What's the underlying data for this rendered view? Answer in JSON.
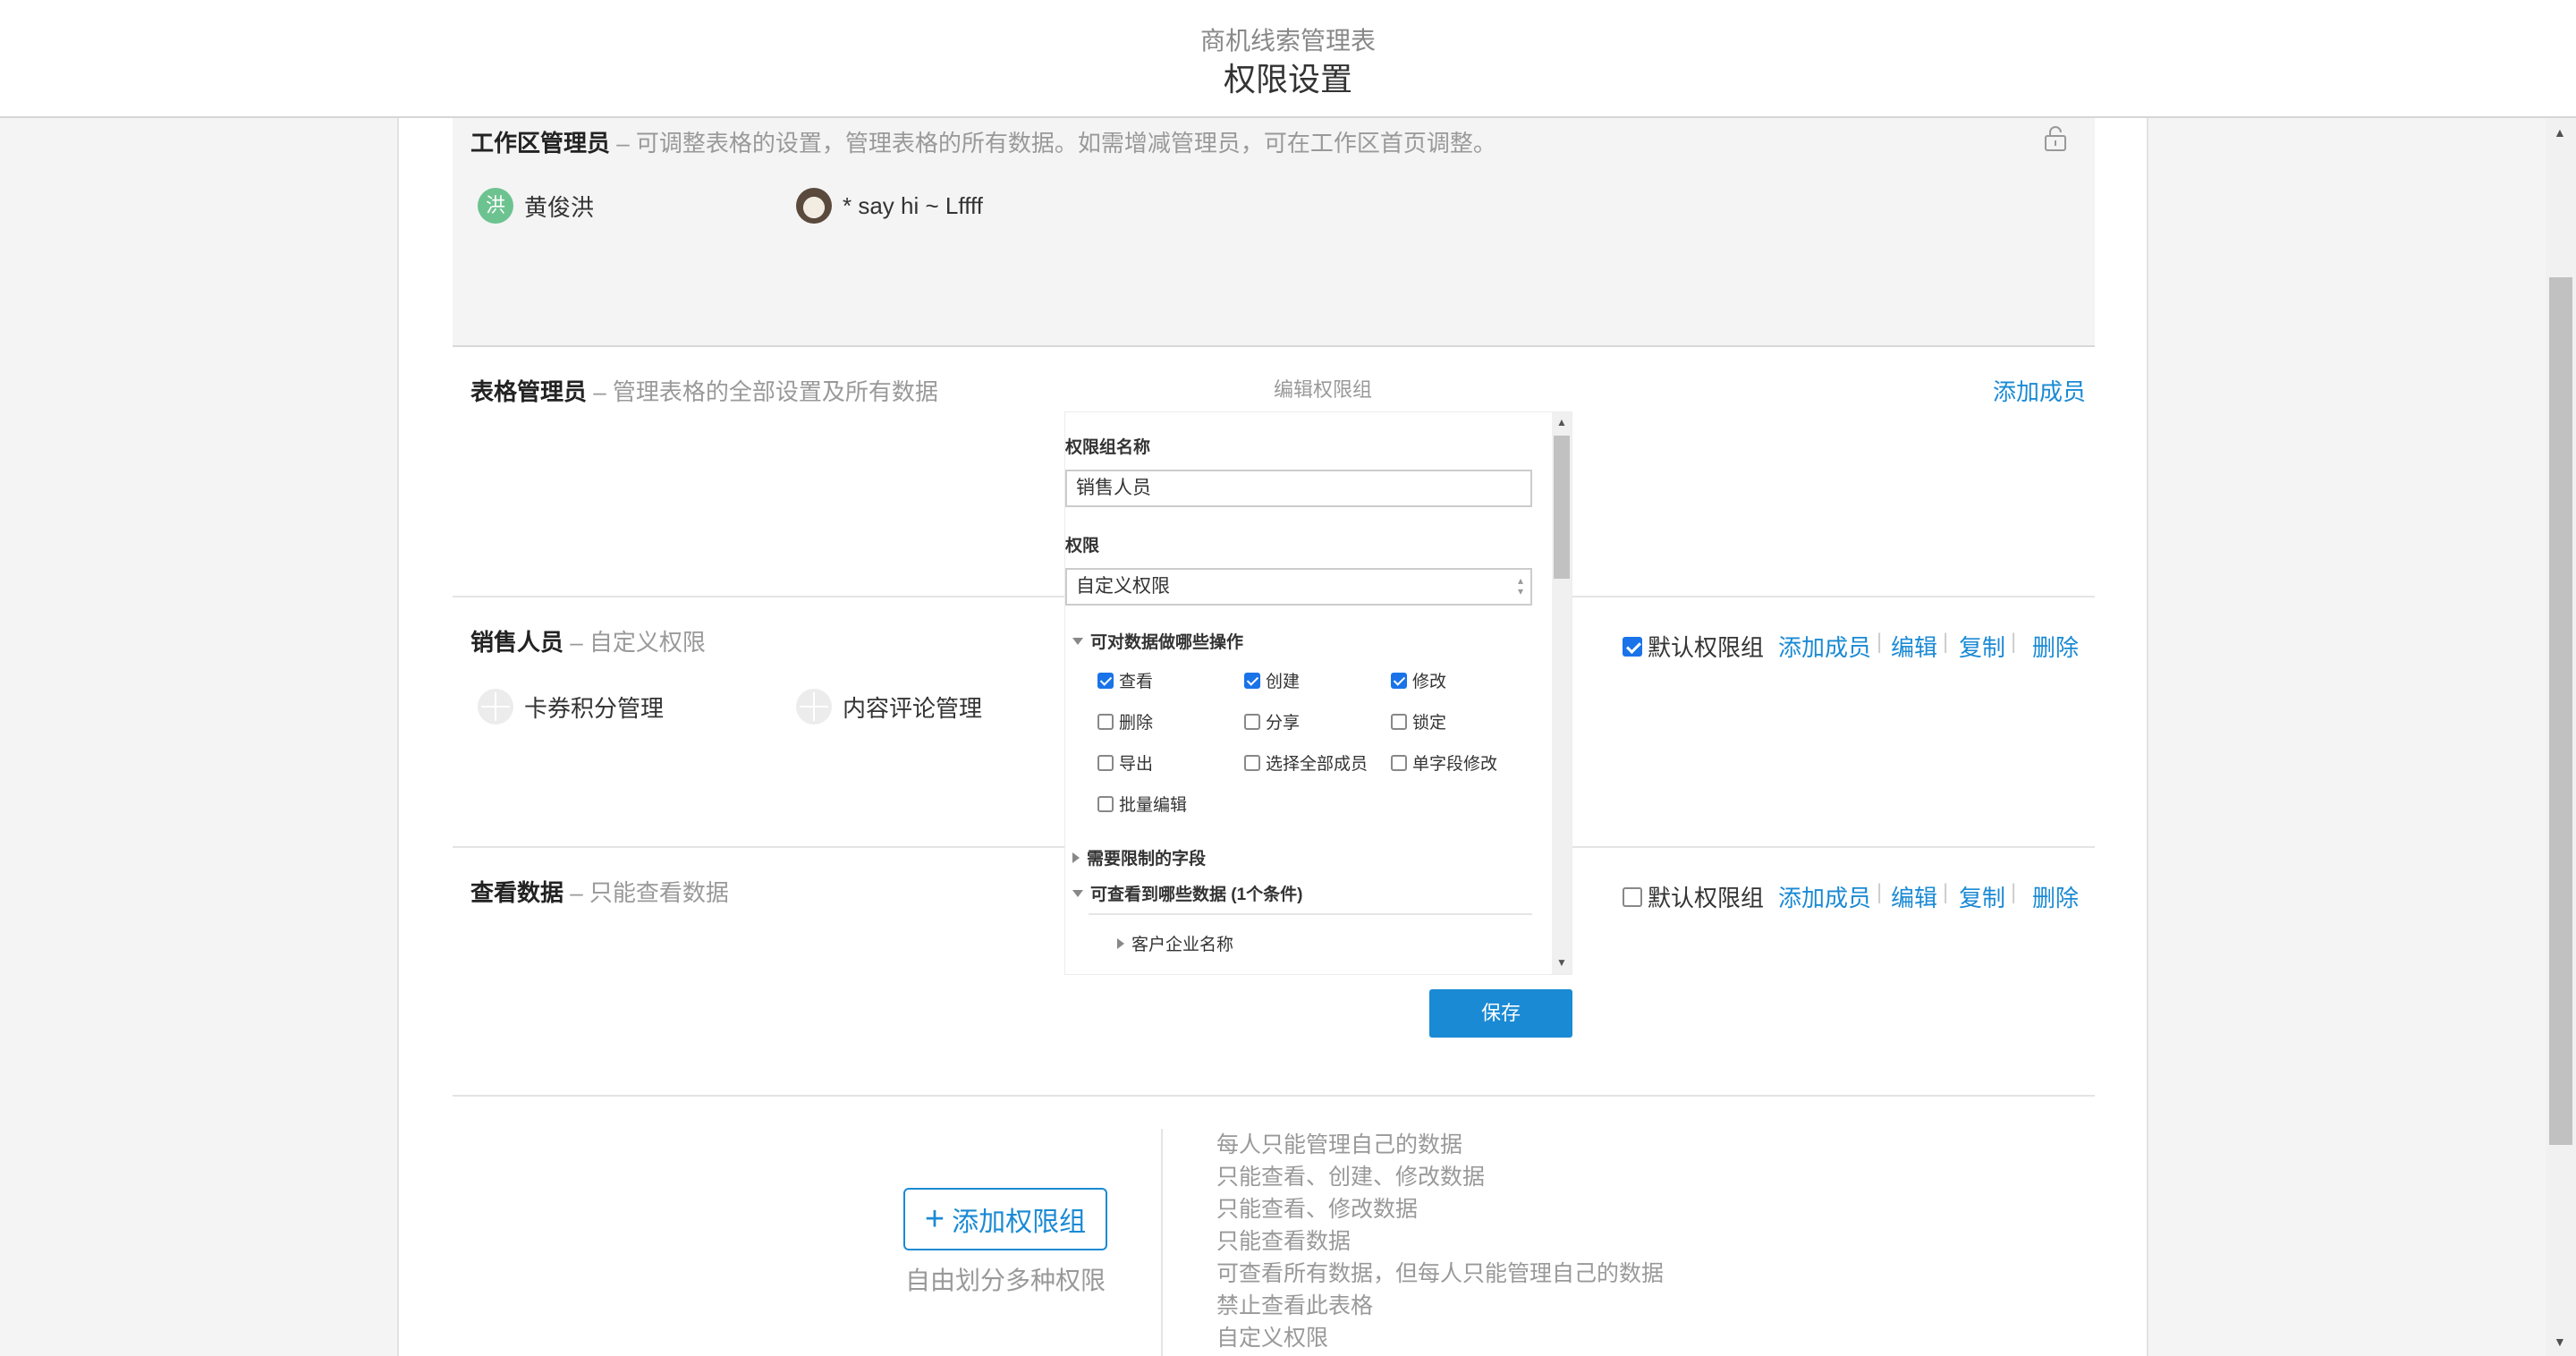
{
  "header": {
    "subtitle": "商机线索管理表",
    "title": "权限设置"
  },
  "sections": {
    "workspace_admin": {
      "title": "工作区管理员",
      "desc": " – 可调整表格的设置，管理表格的所有数据。如需增减管理员，可在工作区首页调整。",
      "members": [
        {
          "avatar_text": "洪",
          "name": "黄俊洪"
        },
        {
          "name": "* say hi ~ Lffff"
        }
      ]
    },
    "table_admin": {
      "title": "表格管理员",
      "desc": " – 管理表格的全部设置及所有数据",
      "add_member": "添加成员"
    },
    "sales": {
      "title": "销售人员",
      "desc": " – 自定义权限",
      "members": [
        {
          "name": "卡券积分管理"
        },
        {
          "name": "内容评论管理"
        }
      ],
      "default_label": "默认权限组",
      "default_checked": true,
      "actions": {
        "add": "添加成员",
        "edit": "编辑",
        "copy": "复制",
        "delete": "删除"
      }
    },
    "view_data": {
      "title": "查看数据",
      "desc": " – 只能查看数据",
      "default_label": "默认权限组",
      "default_checked": false,
      "actions": {
        "add": "添加成员",
        "edit": "编辑",
        "copy": "复制",
        "delete": "删除"
      }
    }
  },
  "modal": {
    "title": "编辑权限组",
    "group_name_label": "权限组名称",
    "group_name_value": "销售人员",
    "permission_label": "权限",
    "permission_value": "自定义权限",
    "ops_header": "可对数据做哪些操作",
    "ops": [
      {
        "label": "查看",
        "checked": true
      },
      {
        "label": "创建",
        "checked": true
      },
      {
        "label": "修改",
        "checked": true
      },
      {
        "label": "删除",
        "checked": false
      },
      {
        "label": "分享",
        "checked": false
      },
      {
        "label": "锁定",
        "checked": false
      },
      {
        "label": "导出",
        "checked": false
      },
      {
        "label": "选择全部成员",
        "checked": false
      },
      {
        "label": "单字段修改",
        "checked": false
      },
      {
        "label": "批量编辑",
        "checked": false
      }
    ],
    "restricted_fields": "需要限制的字段",
    "visible_data": "可查看到哪些数据 (1个条件)",
    "condition_field": "客户企业名称",
    "save": "保存"
  },
  "add_group": {
    "label": "添加权限组",
    "hint": "自由划分多种权限",
    "presets": [
      "每人只能管理自己的数据",
      "只能查看、创建、修改数据",
      "只能查看、修改数据",
      "只能查看数据",
      "可查看所有数据，但每人只能管理自己的数据",
      "禁止查看此表格",
      "自定义权限"
    ]
  },
  "colors": {
    "accent": "#1a8ad4",
    "checkbox": "#1a73e8",
    "avatar_green": "#6cc38f"
  },
  "icons": [
    "lock-icon",
    "plus-icon",
    "triangle-down-icon",
    "triangle-right-icon"
  ]
}
